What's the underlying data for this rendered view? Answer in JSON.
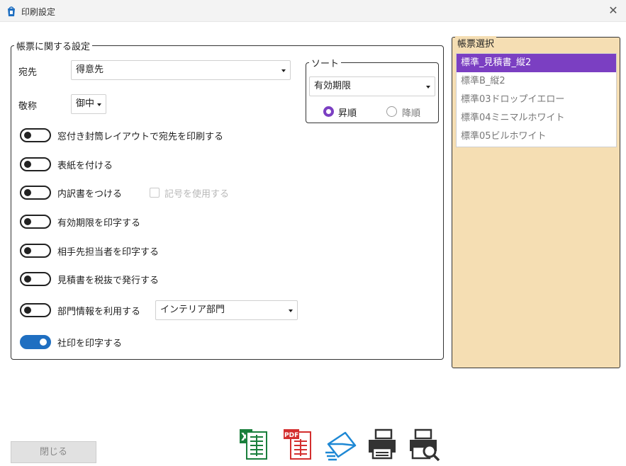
{
  "window": {
    "title": "印刷設定"
  },
  "form_settings": {
    "legend": "帳票に関する設定",
    "recipient": {
      "label": "宛先",
      "value": "得意先"
    },
    "honorific": {
      "label": "敬称",
      "value": "御中"
    },
    "options": [
      {
        "label": "窓付き封筒レイアウトで宛先を印刷する",
        "on": false
      },
      {
        "label": "表紙を付ける",
        "on": false
      },
      {
        "label": "内訳書をつける",
        "on": false
      },
      {
        "label": "有効期限を印字する",
        "on": false
      },
      {
        "label": "相手先担当者を印字する",
        "on": false
      },
      {
        "label": "見積書を税抜で発行する",
        "on": false
      },
      {
        "label": "部門情報を利用する",
        "on": false
      },
      {
        "label": "社印を印字する",
        "on": true
      }
    ],
    "symbol_checkbox_label": "記号を使用する",
    "department_value": "インテリア部門"
  },
  "sort": {
    "legend": "ソート",
    "value": "有効期限",
    "ascending_label": "昇順",
    "descending_label": "降順"
  },
  "template_select": {
    "legend": "帳票選択",
    "items": [
      "標準_見積書_縦2",
      "標準B_縦2",
      "標準03ドロップイエロー",
      "標準04ミニマルホワイト",
      "標準05ビルホワイト"
    ]
  },
  "footer": {
    "close_label": "閉じる"
  },
  "icons": {
    "excel": "excel-export-icon",
    "pdf": "pdf-export-icon",
    "mail": "mail-send-icon",
    "print": "printer-icon",
    "preview": "print-preview-icon"
  }
}
